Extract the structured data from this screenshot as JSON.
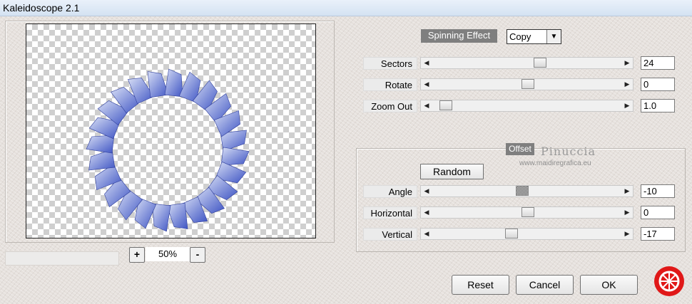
{
  "window": {
    "title": "Kaleidoscope 2.1"
  },
  "preview": {
    "zoom_plus": "+",
    "zoom_minus": "-",
    "zoom_level": "50%"
  },
  "spinning": {
    "label": "Spinning Effect",
    "mode_value": "Copy",
    "sliders": [
      {
        "label": "Sectors",
        "value": "24",
        "position": 0.57
      },
      {
        "label": "Rotate",
        "value": "0",
        "position": 0.5
      },
      {
        "label": "Zoom Out",
        "value": "1.0",
        "position": 0.04
      }
    ]
  },
  "offset": {
    "label": "Offset",
    "random_button": "Random",
    "sliders": [
      {
        "label": "Angle",
        "value": "-10",
        "position": 0.47
      },
      {
        "label": "Horizontal",
        "value": "0",
        "position": 0.5
      },
      {
        "label": "Vertical",
        "value": "-17",
        "position": 0.41
      }
    ]
  },
  "watermark": {
    "name": "Pinuccia",
    "site": "www.maidiregrafica.eu"
  },
  "buttons": {
    "reset": "Reset",
    "cancel": "Cancel",
    "ok": "OK"
  },
  "colors": {
    "ring_light": "#c9d3f0",
    "ring_dark": "#3f55c4",
    "logo_red": "#e01818"
  },
  "icons": {
    "scroll_left": "left-arrow-icon",
    "scroll_right": "right-arrow-icon",
    "dropdown": "chevron-down-icon",
    "logo": "logo-icon"
  }
}
